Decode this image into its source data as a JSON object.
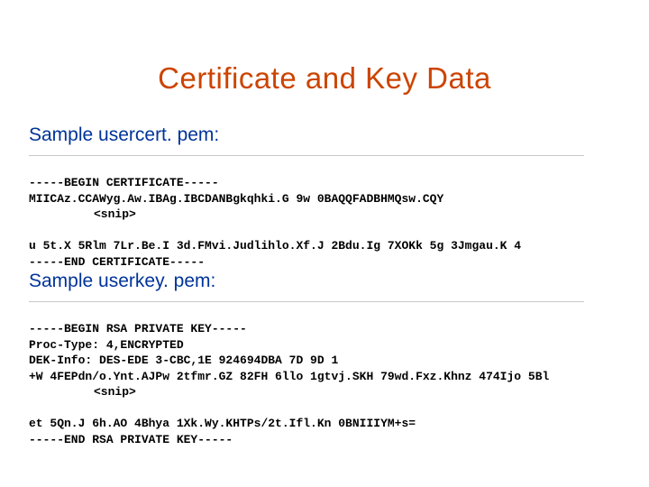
{
  "title": "Certificate and Key Data",
  "sections": {
    "cert": {
      "label": "Sample usercert. pem:",
      "lines": {
        "l0": "-----BEGIN CERTIFICATE-----",
        "l1": "MIICAz.CCAWyg.Aw.IBAg.IBCDANBgkqhki.G 9w 0BAQQFADBHMQsw.CQY",
        "snip": "<snip>",
        "l2": "u 5t.X 5Rlm 7Lr.Be.I 3d.FMvi.Judlihlo.Xf.J 2Bdu.Ig 7XOKk 5g 3Jmgau.K 4",
        "l3": "-----END CERTIFICATE-----"
      }
    },
    "key": {
      "label": "Sample userkey. pem:",
      "lines": {
        "l0": "-----BEGIN RSA PRIVATE KEY-----",
        "l1": "Proc-Type: 4,ENCRYPTED",
        "l2": "DEK-Info: DES-EDE 3-CBC,1E 924694DBA 7D 9D 1",
        "l3": "+W 4FEPdn/o.Ynt.AJPw 2tfmr.GZ 82FH 6llo 1gtvj.SKH 79wd.Fxz.Khnz 474Ijo 5Bl",
        "snip": "<snip>",
        "l4": "et 5Qn.J 6h.AO 4Bhya 1Xk.Wy.KHTPs/2t.Ifl.Kn 0BNIIIYM+s=",
        "l5": "-----END RSA PRIVATE KEY-----"
      }
    }
  }
}
